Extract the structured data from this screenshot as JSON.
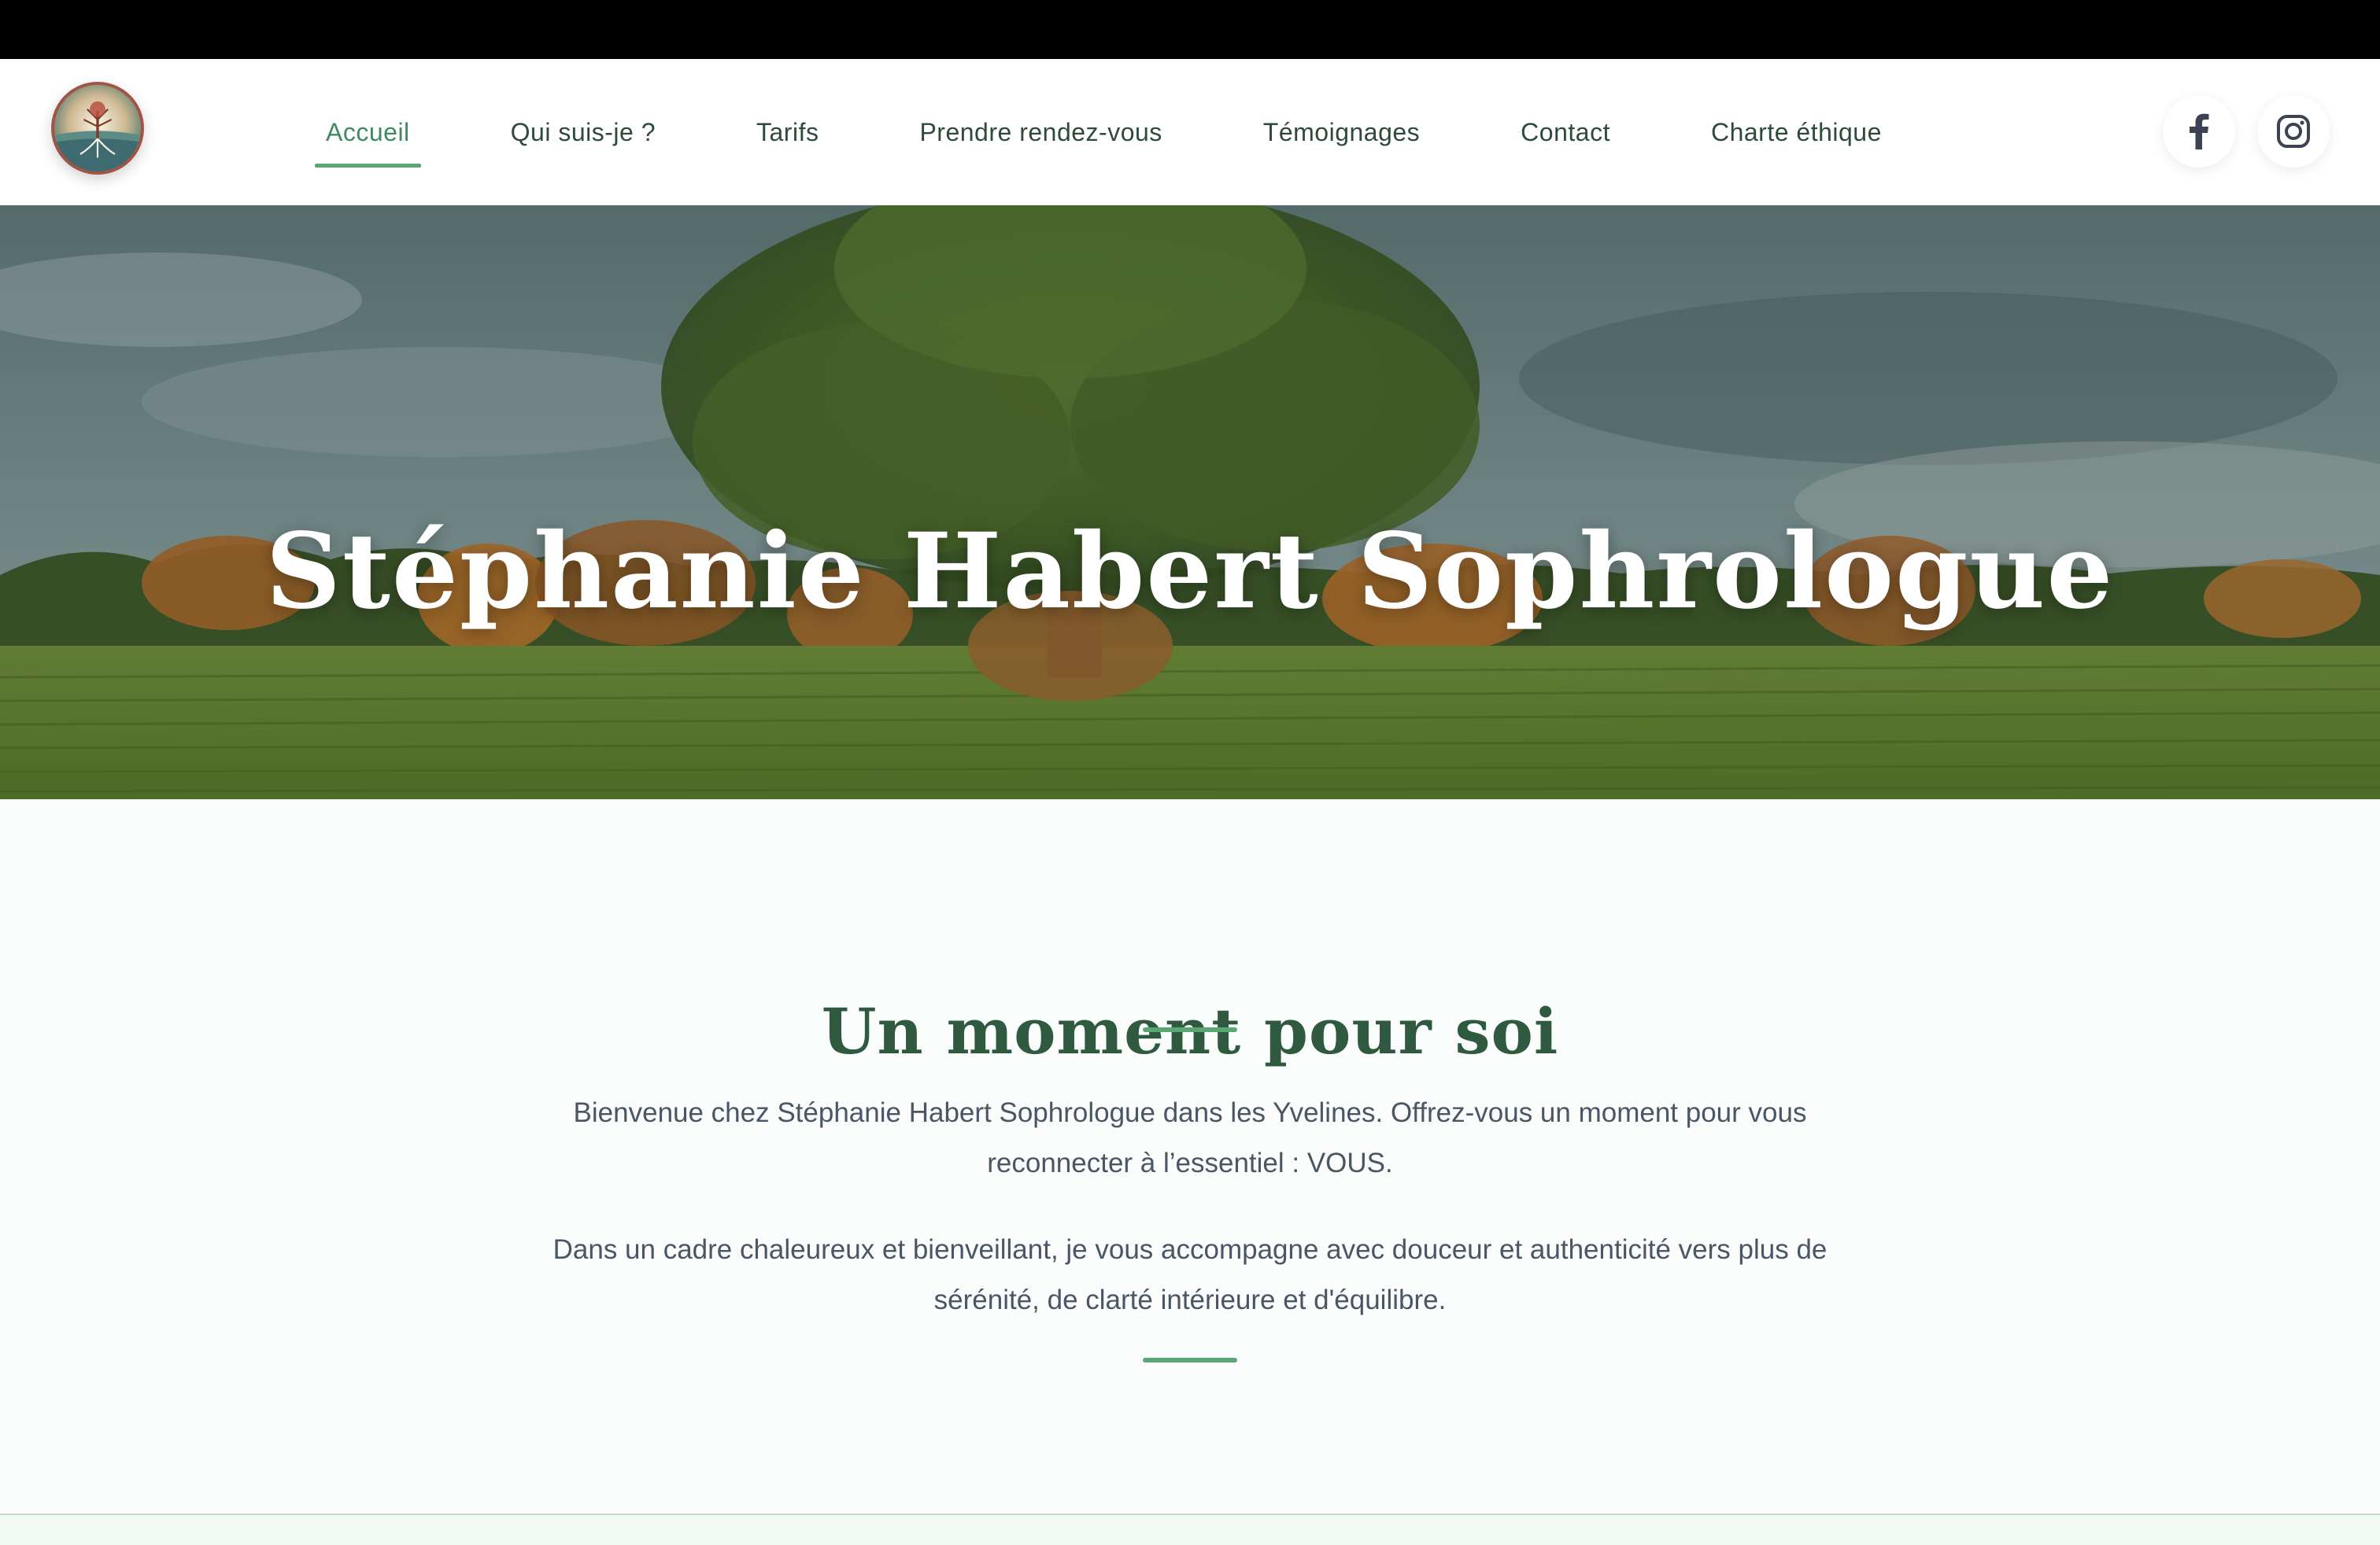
{
  "nav": {
    "links": [
      {
        "label": "Accueil",
        "active": true
      },
      {
        "label": "Qui suis-je ?"
      },
      {
        "label": "Tarifs"
      },
      {
        "label": "Prendre rendez-vous"
      },
      {
        "label": "Témoignages"
      },
      {
        "label": "Contact"
      },
      {
        "label": "Charte éthique"
      }
    ],
    "social": [
      {
        "icon": "facebook-icon"
      },
      {
        "icon": "instagram-icon"
      }
    ]
  },
  "hero": {
    "title": "Stéphanie Habert Sophrologue"
  },
  "intro": {
    "title": "Un moment pour soi",
    "paragraph1": "Bienvenue chez Stéphanie Habert Sophrologue dans les Yvelines. Offrez-vous un moment pour vous reconnecter à l’essentiel : VOUS.",
    "paragraph2": "Dans un cadre chaleureux et bienveillant, je vous accompagne avec douceur et authenticité vers plus de sérénité, de clarté intérieure et d'équilibre."
  },
  "colors": {
    "accent": "#5aa774",
    "heading": "#2f5a3f",
    "nav_text": "#2e4a3b",
    "body_text": "#4a5666"
  }
}
